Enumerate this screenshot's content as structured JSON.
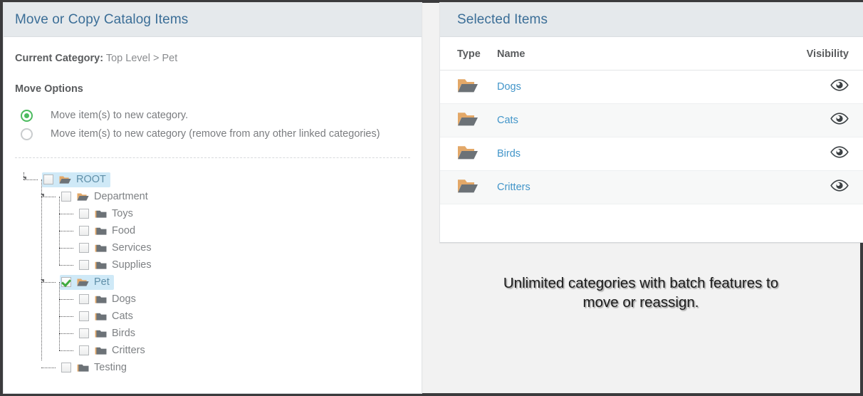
{
  "left_panel": {
    "title": "Move or Copy Catalog Items",
    "current_category": {
      "label": "Current Category:",
      "value": "Top Level > Pet"
    },
    "move_options": {
      "heading": "Move Options",
      "options": [
        {
          "label": "Move item(s) to new category.",
          "selected": true
        },
        {
          "label": "Move item(s) to new category (remove from any other linked categories)",
          "selected": false
        }
      ]
    },
    "tree": {
      "nodes": [
        {
          "label": "ROOT",
          "depth": 0,
          "icon": "open-folder-icon",
          "checked": false,
          "selected": true,
          "expander": true
        },
        {
          "label": "Department",
          "depth": 1,
          "icon": "open-folder-icon",
          "checked": false,
          "selected": false,
          "expander": true
        },
        {
          "label": "Toys",
          "depth": 2,
          "icon": "closed-folder-icon",
          "checked": false,
          "selected": false,
          "expander": false
        },
        {
          "label": "Food",
          "depth": 2,
          "icon": "closed-folder-icon",
          "checked": false,
          "selected": false,
          "expander": false
        },
        {
          "label": "Services",
          "depth": 2,
          "icon": "closed-folder-icon",
          "checked": false,
          "selected": false,
          "expander": false
        },
        {
          "label": "Supplies",
          "depth": 2,
          "icon": "closed-folder-icon",
          "checked": false,
          "selected": false,
          "expander": false
        },
        {
          "label": "Pet",
          "depth": 1,
          "icon": "open-folder-icon",
          "checked": true,
          "selected": true,
          "expander": true
        },
        {
          "label": "Dogs",
          "depth": 2,
          "icon": "closed-folder-icon",
          "checked": false,
          "selected": false,
          "expander": false
        },
        {
          "label": "Cats",
          "depth": 2,
          "icon": "closed-folder-icon",
          "checked": false,
          "selected": false,
          "expander": false
        },
        {
          "label": "Birds",
          "depth": 2,
          "icon": "closed-folder-icon",
          "checked": false,
          "selected": false,
          "expander": false
        },
        {
          "label": "Critters",
          "depth": 2,
          "icon": "closed-folder-icon",
          "checked": false,
          "selected": false,
          "expander": false
        },
        {
          "label": "Testing",
          "depth": 1,
          "icon": "closed-folder-icon",
          "checked": false,
          "selected": false,
          "expander": false
        }
      ]
    }
  },
  "right_panel": {
    "title": "Selected Items",
    "table": {
      "columns": [
        "Type",
        "Name",
        "Visibility"
      ],
      "rows": [
        {
          "type_icon": "open-folder-icon",
          "name": "Dogs",
          "visibility_icon": "eye-icon"
        },
        {
          "type_icon": "open-folder-icon",
          "name": "Cats",
          "visibility_icon": "eye-icon"
        },
        {
          "type_icon": "open-folder-icon",
          "name": "Birds",
          "visibility_icon": "eye-icon"
        },
        {
          "type_icon": "open-folder-icon",
          "name": "Critters",
          "visibility_icon": "eye-icon"
        }
      ]
    }
  },
  "caption": {
    "line1": "Unlimited categories with batch features to",
    "line2": "move or reassign."
  },
  "colors": {
    "panel_header_bg": "#e5e9ec",
    "panel_header_title": "#3b6e97",
    "link": "#4295c9",
    "radio_selected": "#4cbb5f",
    "tree_selection": "#cfe9f7",
    "folder_accent": "#e0a060",
    "folder_body": "#6c7277",
    "frame": "#3b3b3d",
    "page_bg": "#f2f2f2"
  }
}
